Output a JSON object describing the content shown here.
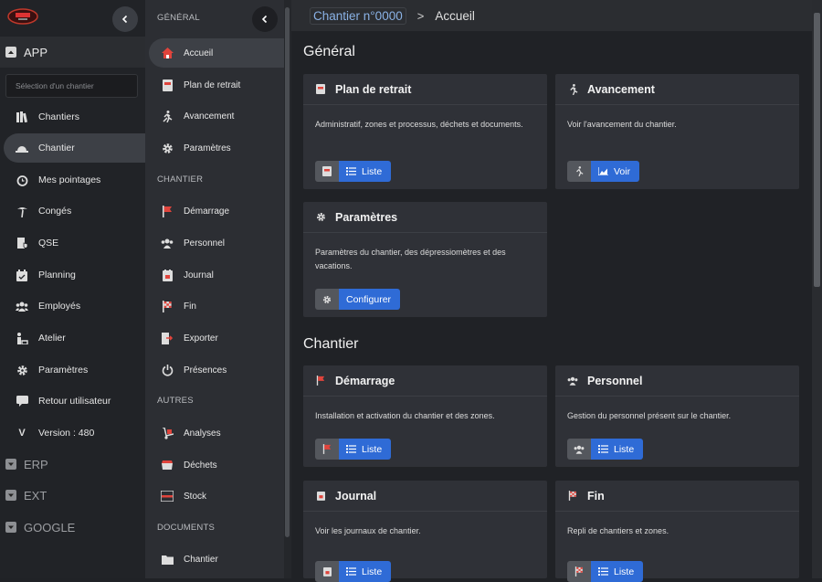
{
  "sidebar_main": {
    "sections": {
      "app": "APP",
      "erp": "ERP",
      "ext": "EXT",
      "google": "GOOGLE"
    },
    "select_placeholder": "Sélection d'un chantier",
    "items": [
      {
        "label": "Chantiers",
        "icon": "books-icon"
      },
      {
        "label": "Chantier",
        "icon": "hardhat-icon",
        "active": true
      },
      {
        "label": "Mes pointages",
        "icon": "alarm-clock-icon"
      },
      {
        "label": "Congés",
        "icon": "palm-tree-icon"
      },
      {
        "label": "QSE",
        "icon": "file-shield-icon"
      },
      {
        "label": "Planning",
        "icon": "calendar-icon"
      },
      {
        "label": "Employés",
        "icon": "users-icon"
      },
      {
        "label": "Atelier",
        "icon": "worker-icon"
      },
      {
        "label": "Paramètres",
        "icon": "gear-icon"
      },
      {
        "label": "Retour utilisateur",
        "icon": "comment-icon"
      },
      {
        "label": "Version : 480",
        "icon": "v-letter-icon"
      }
    ]
  },
  "sidebar_chantier": {
    "categories": {
      "general": "GÉNÉRAL",
      "chantier": "CHANTIER",
      "autres": "AUTRES",
      "documents": "DOCUMENTS"
    },
    "items": [
      {
        "label": "Accueil",
        "icon": "home-icon",
        "active": true
      },
      {
        "label": "Plan de retrait",
        "icon": "book-icon"
      },
      {
        "label": "Avancement",
        "icon": "running-icon"
      },
      {
        "label": "Paramètres",
        "icon": "gear-icon"
      },
      {
        "label": "Démarrage",
        "icon": "flag-icon"
      },
      {
        "label": "Personnel",
        "icon": "users-icon"
      },
      {
        "label": "Journal",
        "icon": "journal-icon"
      },
      {
        "label": "Fin",
        "icon": "checkered-flag-icon"
      },
      {
        "label": "Exporter",
        "icon": "file-export-icon"
      },
      {
        "label": "Présences",
        "icon": "power-icon"
      },
      {
        "label": "Analyses",
        "icon": "dolly-icon"
      },
      {
        "label": "Déchets",
        "icon": "dumpster-icon"
      },
      {
        "label": "Stock",
        "icon": "pallet-icon"
      },
      {
        "label": "Chantier",
        "icon": "folder-icon"
      }
    ]
  },
  "breadcrumb": {
    "link": "Chantier n°0000",
    "separator": ">",
    "current": "Accueil"
  },
  "main": {
    "sections": {
      "general": "Général",
      "chantier": "Chantier"
    },
    "cards": {
      "plan": {
        "title": "Plan de retrait",
        "text": "Administratif, zones et processus, déchets et documents.",
        "button": "Liste"
      },
      "avancement": {
        "title": "Avancement",
        "text": "Voir l'avancement du chantier.",
        "button": "Voir"
      },
      "parametres": {
        "title": "Paramètres",
        "text": "Paramètres du chantier, des dépressiomètres et des vacations.",
        "button": "Configurer"
      },
      "demarrage": {
        "title": "Démarrage",
        "text": "Installation et activation du chantier et des zones.",
        "button": "Liste"
      },
      "personnel": {
        "title": "Personnel",
        "text": "Gestion du personnel présent sur le chantier.",
        "button": "Liste"
      },
      "journal": {
        "title": "Journal",
        "text": "Voir les journaux de chantier.",
        "button": "Liste"
      },
      "fin": {
        "title": "Fin",
        "text": "Repli de chantiers et zones.",
        "button": "Liste"
      }
    }
  },
  "colors": {
    "accent": "#2f6bd6",
    "red_icon": "#e0443c",
    "link": "#8ab2e6"
  }
}
